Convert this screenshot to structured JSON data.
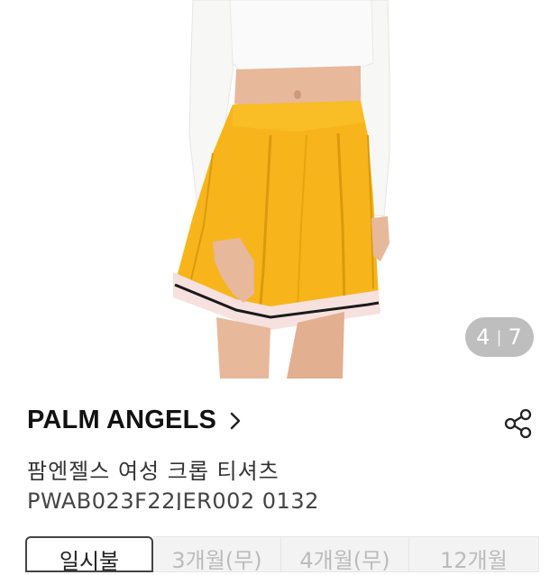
{
  "image_counter": {
    "current": "4",
    "total": "7"
  },
  "product": {
    "brand": "PALM ANGELS",
    "name": "팜엔젤스 여성 크롭 티셔츠",
    "code": "PWAB023F22JER002 0132"
  },
  "option_tabs": [
    {
      "label": "일시불"
    },
    {
      "label": "3개월(무)"
    },
    {
      "label": "4개월(무)"
    },
    {
      "label": "12개월"
    }
  ],
  "icons": {
    "brand_link": "chevron-right-icon",
    "share": "share-icon"
  },
  "colors": {
    "skirt": "#f7b51b",
    "skirt_trim": "#f6e1df",
    "counter_bg": "#969696"
  }
}
